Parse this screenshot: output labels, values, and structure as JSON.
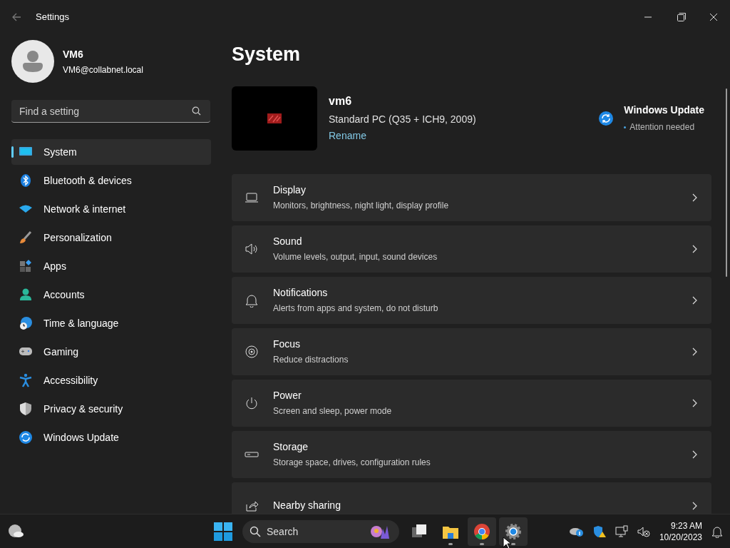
{
  "window": {
    "title": "Settings"
  },
  "account": {
    "name": "VM6",
    "email": "VM6@collabnet.local"
  },
  "search": {
    "placeholder": "Find a setting"
  },
  "sidebar": {
    "items": [
      {
        "label": "System",
        "selected": true
      },
      {
        "label": "Bluetooth & devices",
        "selected": false
      },
      {
        "label": "Network & internet",
        "selected": false
      },
      {
        "label": "Personalization",
        "selected": false
      },
      {
        "label": "Apps",
        "selected": false
      },
      {
        "label": "Accounts",
        "selected": false
      },
      {
        "label": "Time & language",
        "selected": false
      },
      {
        "label": "Gaming",
        "selected": false
      },
      {
        "label": "Accessibility",
        "selected": false
      },
      {
        "label": "Privacy & security",
        "selected": false
      },
      {
        "label": "Windows Update",
        "selected": false
      }
    ]
  },
  "page": {
    "title": "System",
    "device": {
      "name": "vm6",
      "model": "Standard PC (Q35 + ICH9, 2009)",
      "rename": "Rename"
    },
    "update": {
      "title": "Windows Update",
      "status": "Attention needed"
    },
    "cards": [
      {
        "title": "Display",
        "subtitle": "Monitors, brightness, night light, display profile"
      },
      {
        "title": "Sound",
        "subtitle": "Volume levels, output, input, sound devices"
      },
      {
        "title": "Notifications",
        "subtitle": "Alerts from apps and system, do not disturb"
      },
      {
        "title": "Focus",
        "subtitle": "Reduce distractions"
      },
      {
        "title": "Power",
        "subtitle": "Screen and sleep, power mode"
      },
      {
        "title": "Storage",
        "subtitle": "Storage space, drives, configuration rules"
      },
      {
        "title": "Nearby sharing"
      }
    ]
  },
  "taskbar": {
    "search": "Search",
    "apps": [
      {
        "kind": "taskview",
        "running": false
      },
      {
        "kind": "explorer",
        "running": true
      },
      {
        "kind": "chrome",
        "running": true
      },
      {
        "kind": "settings",
        "running": true
      }
    ],
    "time": "9:23 AM",
    "date": "10/20/2023"
  }
}
